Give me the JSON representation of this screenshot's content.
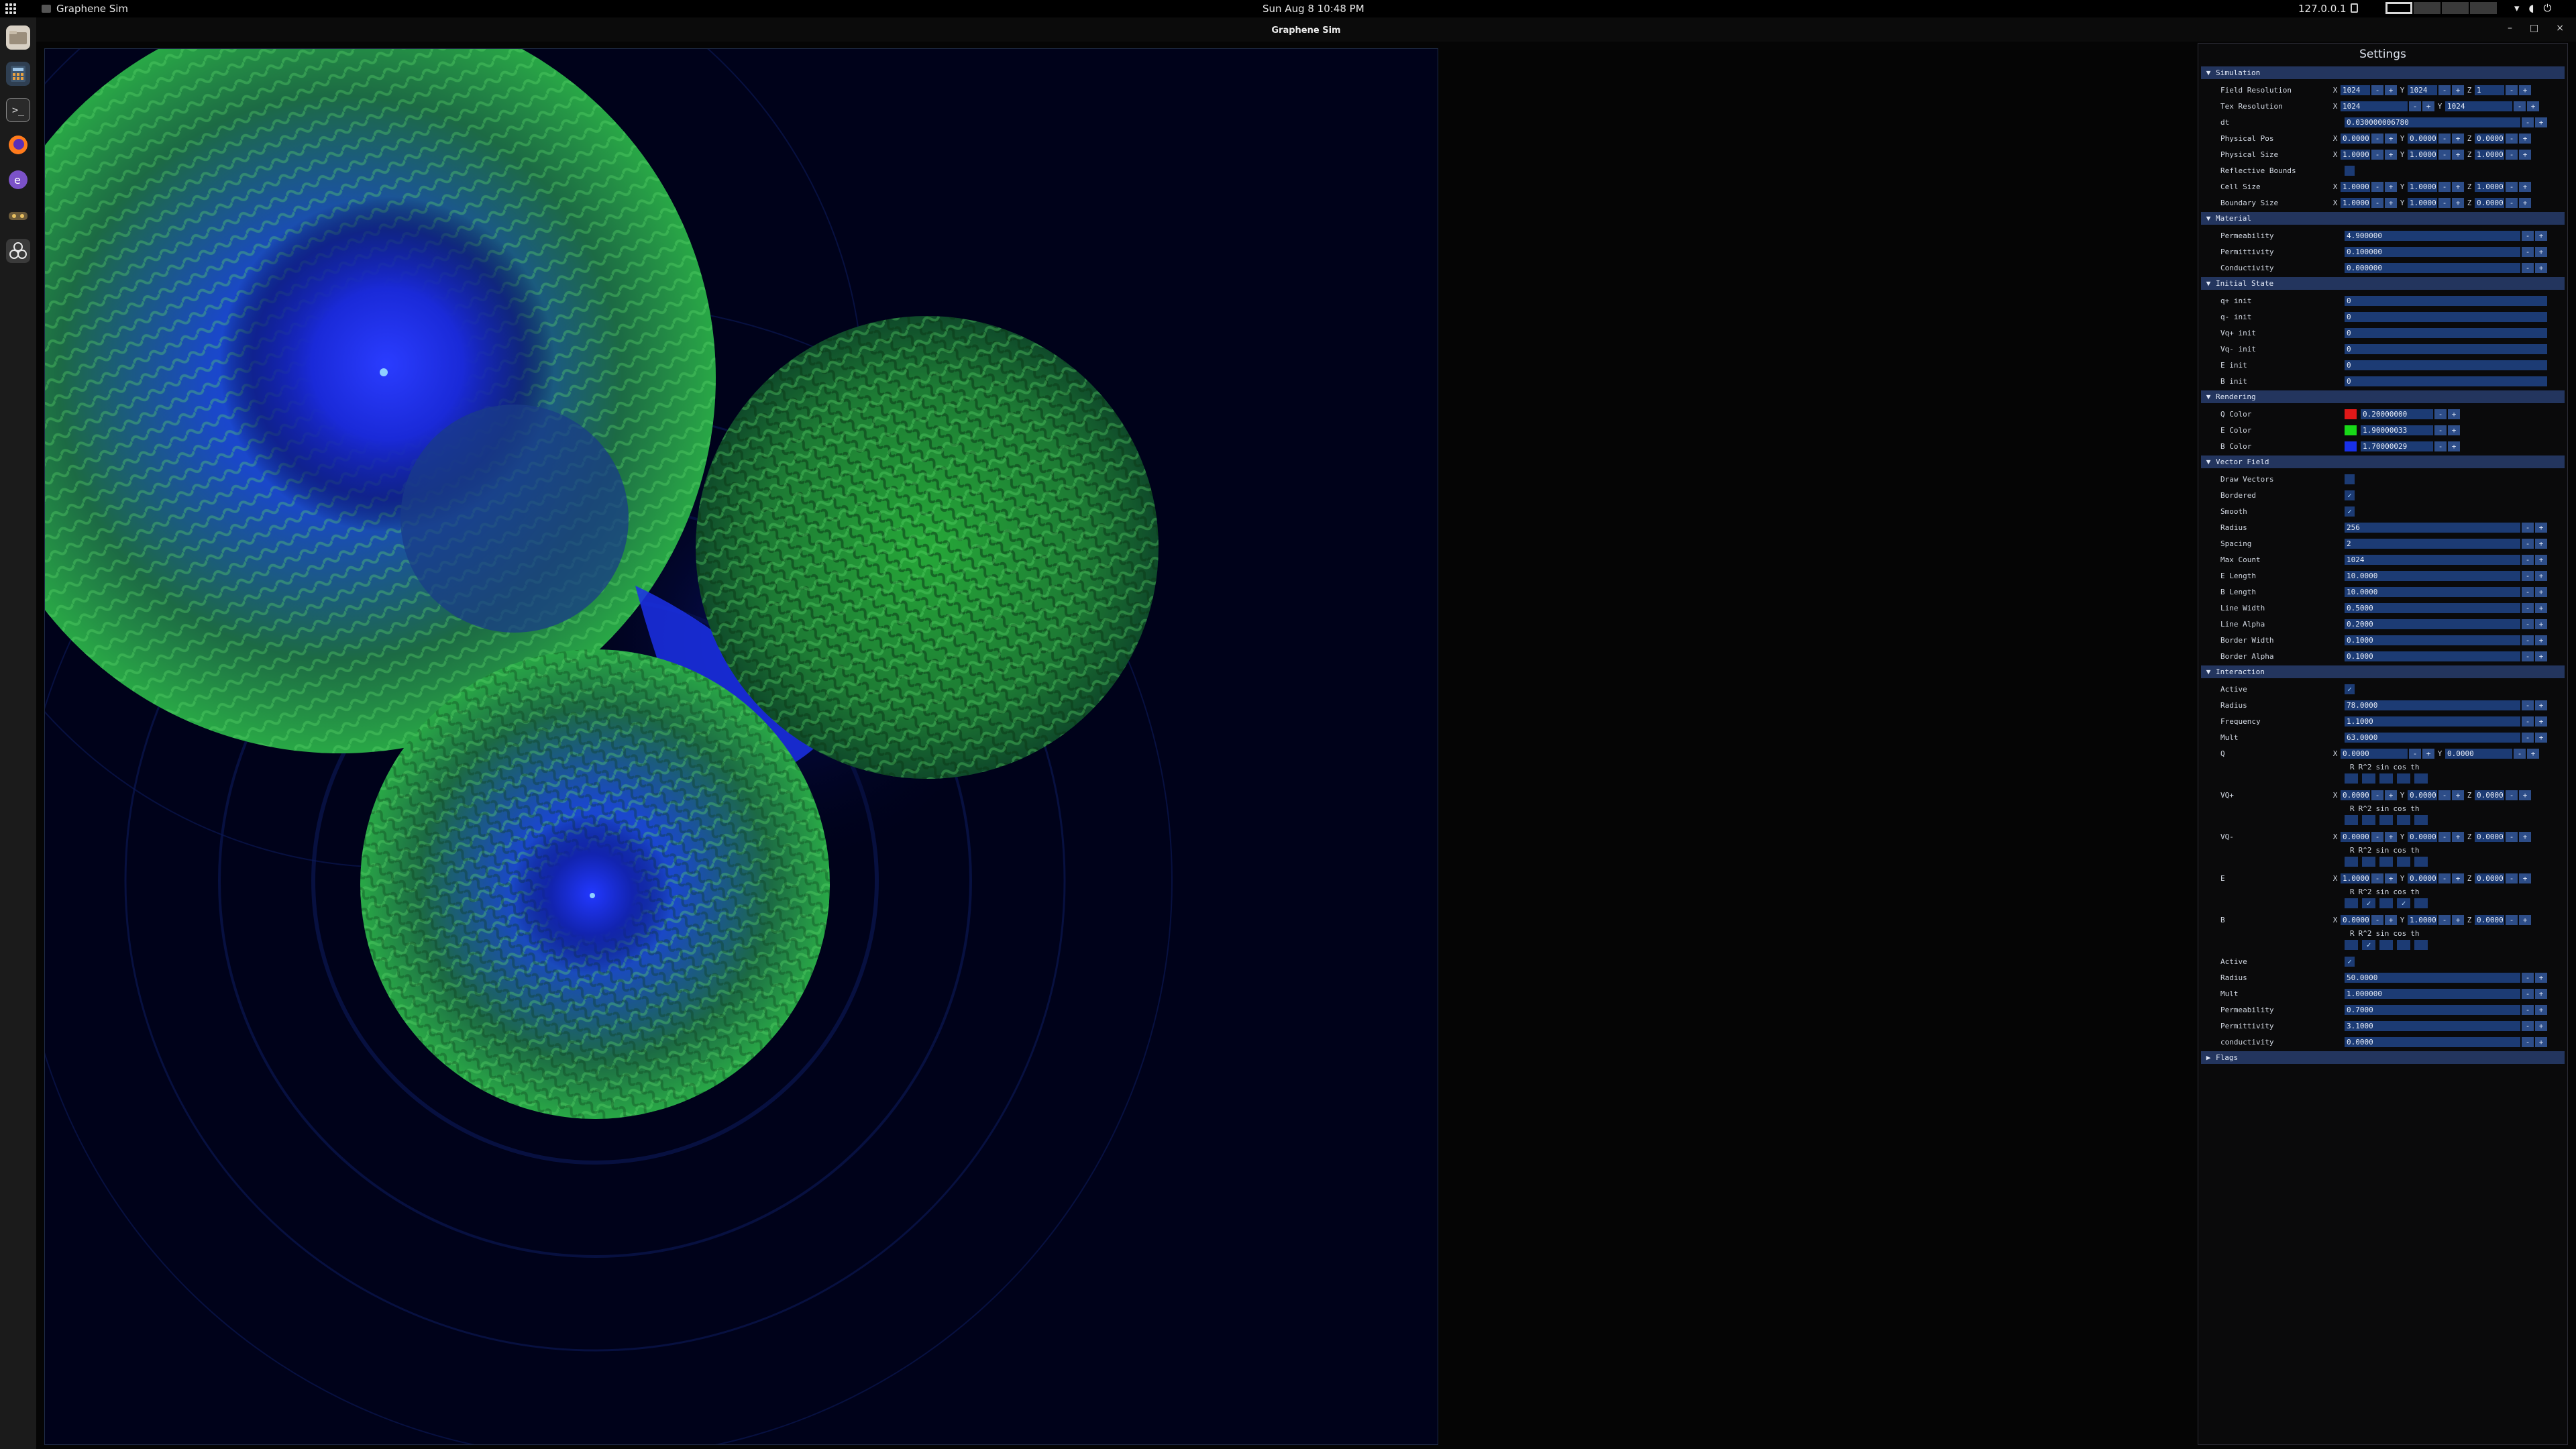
{
  "topbar": {
    "app_name": "Graphene Sim",
    "clock": "Sun Aug 8  10:48 PM",
    "ip": "127.0.0.1",
    "tray_icons": [
      "network-icon",
      "volume-icon",
      "power-icon"
    ]
  },
  "window": {
    "title": "Graphene Sim",
    "minimize": "–",
    "maximize": "□",
    "close": "×"
  },
  "dock": {
    "apps": [
      "files-icon",
      "calculator-icon",
      "terminal-icon",
      "firefox-icon",
      "emacs-icon",
      "gnome-games-icon",
      "graphene-sim-icon"
    ]
  },
  "panel": {
    "title": "Settings",
    "plus": "+",
    "minus": "-",
    "check": "✓",
    "sections": {
      "simulation": "Simulation",
      "material": "Material",
      "initial_state": "Initial State",
      "rendering": "Rendering",
      "vector_field": "Vector Field",
      "interaction": "Interaction",
      "flags": "Flags"
    },
    "simulation": {
      "field_resolution": {
        "label": "Field Resolution",
        "x": "1024",
        "y": "1024",
        "z": "1"
      },
      "tex_resolution": {
        "label": "Tex Resolution",
        "x": "1024",
        "y": "1024"
      },
      "dt": {
        "label": "dt",
        "value": "0.030000006780"
      },
      "physical_pos": {
        "label": "Physical Pos",
        "x": "0.0000",
        "y": "0.0000",
        "z": "0.0000"
      },
      "physical_size": {
        "label": "Physical Size",
        "x": "1.0000",
        "y": "1.0000",
        "z": "1.0000"
      },
      "reflective_bounds": {
        "label": "Reflective Bounds"
      },
      "cell_size": {
        "label": "Cell Size",
        "x": "1.0000",
        "y": "1.0000",
        "z": "1.0000"
      },
      "boundary_size": {
        "label": "Boundary Size",
        "x": "1.0000",
        "y": "1.0000",
        "z": "0.0000"
      }
    },
    "material": {
      "permeability": {
        "label": "Permeability",
        "value": "4.900000"
      },
      "permittivity": {
        "label": "Permittivity",
        "value": "0.100000"
      },
      "conductivity": {
        "label": "Conductivity",
        "value": "0.000000"
      }
    },
    "initial_state": {
      "q_plus": {
        "label": "q+ init",
        "value": "0"
      },
      "q_minus": {
        "label": "q- init",
        "value": "0"
      },
      "vq_plus": {
        "label": "Vq+ init",
        "value": "0"
      },
      "vq_minus": {
        "label": "Vq- init",
        "value": "0"
      },
      "e_init": {
        "label": "E init",
        "value": "0"
      },
      "b_init": {
        "label": "B init",
        "value": "0"
      }
    },
    "rendering": {
      "q_color": {
        "label": "Q Color",
        "value": "0.20000000",
        "color": "#e01818"
      },
      "e_color": {
        "label": "E Color",
        "value": "1.90000033",
        "color": "#18d818"
      },
      "b_color": {
        "label": "B Color",
        "value": "1.70000029",
        "color": "#1830e8"
      }
    },
    "vector_field": {
      "draw_vectors": {
        "label": "Draw Vectors",
        "checked": false
      },
      "bordered": {
        "label": "Bordered",
        "checked": true
      },
      "smooth": {
        "label": "Smooth",
        "checked": true
      },
      "radius": {
        "label": "Radius",
        "value": "256"
      },
      "spacing": {
        "label": "Spacing",
        "value": "2"
      },
      "max_count": {
        "label": "Max Count",
        "value": "1024"
      },
      "e_length": {
        "label": "E Length",
        "value": "10.0000"
      },
      "b_length": {
        "label": "B Length",
        "value": "10.0000"
      },
      "line_width": {
        "label": "Line Width",
        "value": "0.5000"
      },
      "line_alpha": {
        "label": "Line Alpha",
        "value": "0.2000"
      },
      "border_width": {
        "label": "Border Width",
        "value": "0.1000"
      },
      "border_alpha": {
        "label": "Border Alpha",
        "value": "0.1000"
      }
    },
    "interaction": {
      "active": {
        "label": "Active",
        "checked": true
      },
      "radius": {
        "label": "Radius",
        "value": "78.0000"
      },
      "frequency": {
        "label": "Frequency",
        "value": "1.1000"
      },
      "mult": {
        "label": "Mult",
        "value": "63.0000"
      },
      "q": {
        "label": "Q",
        "x": "0.0000",
        "y": "0.0000"
      },
      "vq_plus": {
        "label": "VQ+",
        "x": "0.0000",
        "y": "0.0000",
        "z": "0.0000"
      },
      "vq_minus": {
        "label": "VQ-",
        "x": "0.0000",
        "y": "0.0000",
        "z": "0.0000"
      },
      "e": {
        "label": "E",
        "x": "1.0000",
        "y": "0.0000",
        "z": "0.0000"
      },
      "b": {
        "label": "B",
        "x": "0.0000",
        "y": "1.0000",
        "z": "0.0000"
      },
      "flags_header": {
        "r": "R",
        "r2": "R^2",
        "sin": "sin",
        "cos": "cos",
        "th": "th"
      },
      "active2": {
        "label": "Active",
        "checked": true
      },
      "radius2": {
        "label": "Radius",
        "value": "50.0000"
      },
      "mult2": {
        "label": "Mult",
        "value": "1.000000"
      },
      "permeability2": {
        "label": "Permeability",
        "value": "0.7000"
      },
      "permittivity2": {
        "label": "Permittivity",
        "value": "3.1000"
      },
      "conductivity2": {
        "label": "conductivity",
        "value": "0.0000"
      }
    }
  }
}
